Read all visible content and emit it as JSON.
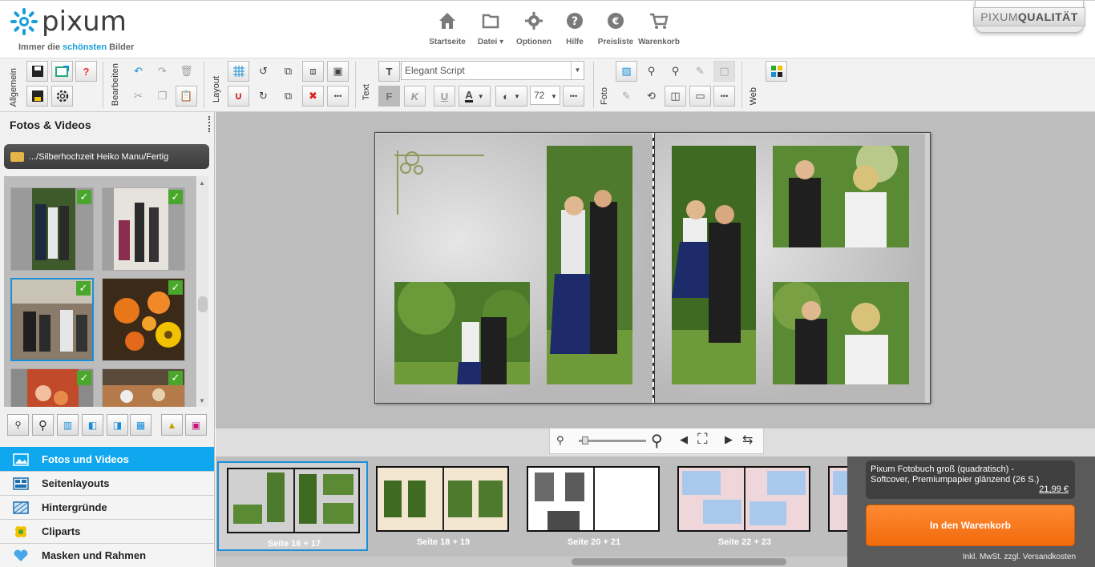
{
  "header": {
    "logo_text": "pixum",
    "tagline_prefix": "Immer die ",
    "tagline_highlight": "schönsten",
    "tagline_suffix": " Bilder",
    "nav": [
      {
        "label": "Startseite",
        "icon": "home-icon"
      },
      {
        "label": "Datei",
        "icon": "folder-icon",
        "dropdown": true
      },
      {
        "label": "Optionen",
        "icon": "gear-icon"
      },
      {
        "label": "Hilfe",
        "icon": "help-icon"
      },
      {
        "label": "Preisliste",
        "icon": "euro-icon"
      },
      {
        "label": "Warenkorb",
        "icon": "cart-icon"
      }
    ],
    "quality_badge_a": "PIXUM",
    "quality_badge_b": "QUALITÄT"
  },
  "toolbar": {
    "groups": [
      "Allgemein",
      "Bearbeiten",
      "Layout",
      "Text",
      "Foto",
      "Web"
    ],
    "font": "Elegant Script",
    "font_size": "72",
    "bold": "F",
    "italic": "K",
    "underline": "U",
    "more": "•••"
  },
  "left": {
    "title": "Fotos & Videos",
    "folder_path": ".../Silberhochzeit Heiko  Manu/Fertig",
    "categories": [
      {
        "label": "Fotos und Videos",
        "active": true
      },
      {
        "label": "Seitenlayouts"
      },
      {
        "label": "Hintergründe"
      },
      {
        "label": "Cliparts"
      },
      {
        "label": "Masken und Rahmen"
      }
    ]
  },
  "filmstrip": {
    "spreads": [
      {
        "label": "Seite 16 + 17",
        "selected": true
      },
      {
        "label": "Seite 18 + 19"
      },
      {
        "label": "Seite 20 + 21"
      },
      {
        "label": "Seite 22 + 23"
      }
    ]
  },
  "cart": {
    "product": "Pixum Fotobuch groß (quadratisch) - Softcover, Premiumpapier glänzend  (26 S.)",
    "price": "21,99 €",
    "button": "In den Warenkorb",
    "tax_note": "Inkl. MwSt. zzgl. Versandkosten"
  },
  "colors": {
    "accent": "#0fa7ee",
    "cart_button": "#f47a20",
    "check": "#49a82b"
  }
}
